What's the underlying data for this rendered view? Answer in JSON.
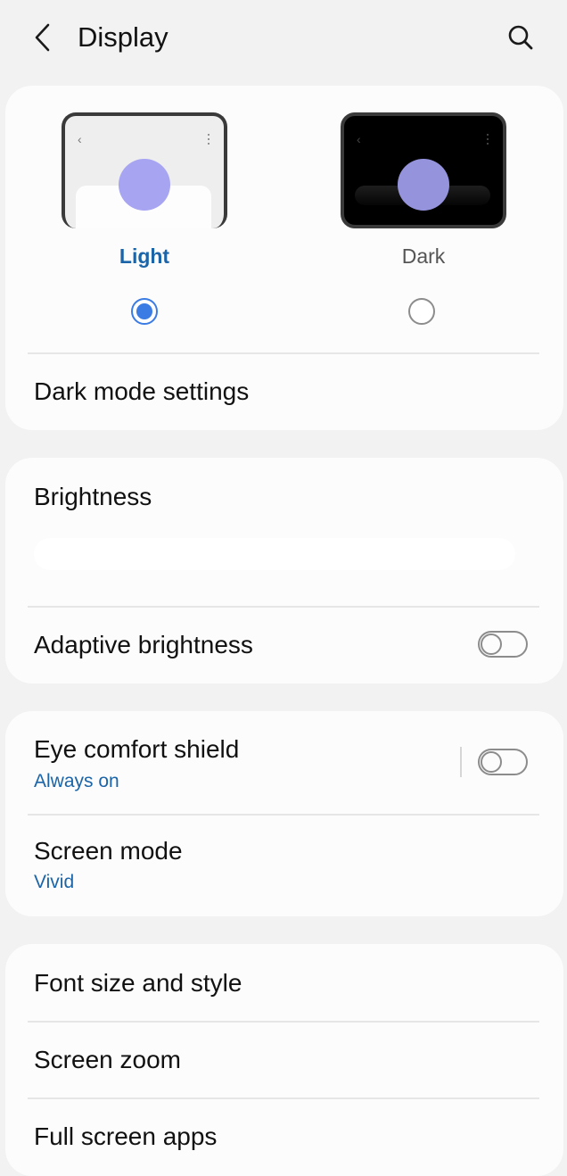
{
  "header": {
    "title": "Display",
    "back_icon": "chevron-left-icon",
    "search_icon": "search-icon"
  },
  "theme": {
    "light_label": "Light",
    "dark_label": "Dark",
    "selected": "Light",
    "accent_color": "#1b64a8",
    "radio_color": "#3b7be4"
  },
  "items": {
    "dark_mode_settings": "Dark mode settings",
    "brightness": "Brightness",
    "adaptive_brightness": "Adaptive brightness",
    "adaptive_brightness_on": false,
    "eye_comfort_shield": "Eye comfort shield",
    "eye_comfort_shield_sub": "Always on",
    "eye_comfort_shield_on": false,
    "screen_mode": "Screen mode",
    "screen_mode_sub": "Vivid",
    "font_size_and_style": "Font size and style",
    "screen_zoom": "Screen zoom",
    "full_screen_apps": "Full screen apps"
  }
}
